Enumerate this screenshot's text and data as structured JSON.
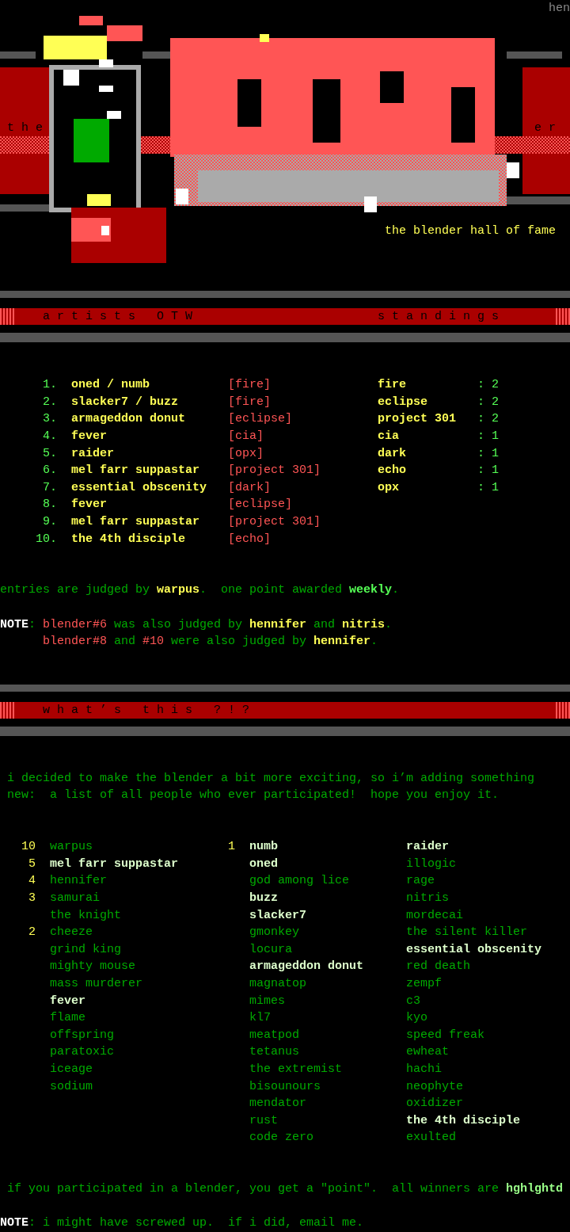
{
  "signature": "hen",
  "logo": {
    "prefix": "t h e",
    "suffix": "e r"
  },
  "tagline": "the blender hall of fame",
  "artists_section": {
    "heading": "a r t i s t s   O T W",
    "heading_right": "s t a n d i n g s",
    "winners": [
      {
        "rank": "1.",
        "artists": "oned / numb",
        "group": "[fire]"
      },
      {
        "rank": "2.",
        "artists": "slacker7 / buzz",
        "group": "[fire]"
      },
      {
        "rank": "3.",
        "artists": "armageddon donut",
        "group": "[eclipse]"
      },
      {
        "rank": "4.",
        "artists": "fever",
        "group": "[cia]"
      },
      {
        "rank": "5.",
        "artists": "raider",
        "group": "[opx]"
      },
      {
        "rank": "6.",
        "artists": "mel farr suppastar",
        "group": "[project 301]"
      },
      {
        "rank": "7.",
        "artists": "essential obscenity",
        "group": "[dark]"
      },
      {
        "rank": "8.",
        "artists": "fever",
        "group": "[eclipse]"
      },
      {
        "rank": "9.",
        "artists": "mel farr suppastar",
        "group": "[project 301]"
      },
      {
        "rank": "10.",
        "artists": "the 4th disciple",
        "group": "[echo]"
      }
    ],
    "standings": [
      {
        "group": "fire",
        "separator": ":",
        "points": "2"
      },
      {
        "group": "eclipse",
        "separator": ":",
        "points": "2"
      },
      {
        "group": "project 301",
        "separator": ":",
        "points": "2"
      },
      {
        "group": "cia",
        "separator": ":",
        "points": "1"
      },
      {
        "group": "dark",
        "separator": ":",
        "points": "1"
      },
      {
        "group": "echo",
        "separator": ":",
        "points": "1"
      },
      {
        "group": "opx",
        "separator": ":",
        "points": "1"
      }
    ],
    "judging": [
      {
        "text": "entries are judged by ",
        "kind": "plain"
      },
      {
        "text": "warpus",
        "kind": "name"
      },
      {
        "text": ".  one point awarded ",
        "kind": "plain"
      },
      {
        "text": "weekly",
        "kind": "highlight"
      },
      {
        "text": ".",
        "kind": "plain"
      }
    ],
    "note": {
      "label": [
        {
          "text": "NOTE",
          "kind": "label"
        },
        {
          "text": ":",
          "kind": "plain"
        }
      ],
      "lines": [
        [
          {
            "text": "blender#6",
            "kind": "tag"
          },
          {
            "text": " was also judged by ",
            "kind": "plain"
          },
          {
            "text": "hennifer",
            "kind": "name"
          },
          {
            "text": " and ",
            "kind": "plain"
          },
          {
            "text": "nitris",
            "kind": "name"
          },
          {
            "text": ".",
            "kind": "plain"
          }
        ],
        [
          {
            "text": "blender#8",
            "kind": "tag"
          },
          {
            "text": " and ",
            "kind": "plain"
          },
          {
            "text": "#10",
            "kind": "tag"
          },
          {
            "text": " were also judged by ",
            "kind": "plain"
          },
          {
            "text": "hennifer",
            "kind": "name"
          },
          {
            "text": ".",
            "kind": "plain"
          }
        ]
      ]
    }
  },
  "about_section": {
    "heading": "w h a t ’ s   t h i s   ? ! ?",
    "intro_lines": [
      "i decided to make the blender a bit more exciting, so i’m adding something",
      "new:  a list of all people who ever participated!  hope you enjoy it."
    ],
    "participants": [
      [
        {
          "points": "10",
          "name": "warpus",
          "winner": false
        },
        {
          "points": "5",
          "name": "mel farr suppastar",
          "winner": true
        },
        {
          "points": "4",
          "name": "hennifer",
          "winner": false
        },
        {
          "points": "3",
          "name": "samurai",
          "winner": false
        },
        {
          "name": "the knight",
          "winner": false
        },
        {
          "points": "2",
          "name": "cheeze",
          "winner": false
        },
        {
          "name": "grind king",
          "winner": false
        },
        {
          "name": "mighty mouse",
          "winner": false
        },
        {
          "name": "mass murderer",
          "winner": false
        },
        {
          "name": "fever",
          "winner": true
        },
        {
          "name": "flame",
          "winner": false
        },
        {
          "name": "offspring",
          "winner": false
        },
        {
          "name": "paratoxic",
          "winner": false
        },
        {
          "name": "iceage",
          "winner": false
        },
        {
          "name": "sodium",
          "winner": false
        }
      ],
      [
        {
          "points": "1",
          "name": "numb",
          "winner": true
        },
        {
          "name": "oned",
          "winner": true
        },
        {
          "name": "god among lice",
          "winner": false
        },
        {
          "name": "buzz",
          "winner": true
        },
        {
          "name": "slacker7",
          "winner": true
        },
        {
          "name": "gmonkey",
          "winner": false
        },
        {
          "name": "locura",
          "winner": false
        },
        {
          "name": "armageddon donut",
          "winner": true
        },
        {
          "name": "magnatop",
          "winner": false
        },
        {
          "name": "mimes",
          "winner": false
        },
        {
          "name": "kl7",
          "winner": false
        },
        {
          "name": "meatpod",
          "winner": false
        },
        {
          "name": "tetanus",
          "winner": false
        },
        {
          "name": "the extremist",
          "winner": false
        },
        {
          "name": "bisounours",
          "winner": false
        },
        {
          "name": "mendator",
          "winner": false
        },
        {
          "name": "rust",
          "winner": false
        },
        {
          "name": "code zero",
          "winner": false
        }
      ],
      [
        {
          "name": "raider",
          "winner": true
        },
        {
          "name": "illogic",
          "winner": false
        },
        {
          "name": "rage",
          "winner": false
        },
        {
          "name": "nitris",
          "winner": false
        },
        {
          "name": "mordecai",
          "winner": false
        },
        {
          "name": "the silent killer",
          "winner": false
        },
        {
          "name": "essential obscenity",
          "winner": true
        },
        {
          "name": "red death",
          "winner": false
        },
        {
          "name": "zempf",
          "winner": false
        },
        {
          "name": "c3",
          "winner": false
        },
        {
          "name": "kyo",
          "winner": false
        },
        {
          "name": "speed freak",
          "winner": false
        },
        {
          "name": "ewheat",
          "winner": false
        },
        {
          "name": "hachi",
          "winner": false
        },
        {
          "name": "neophyte",
          "winner": false
        },
        {
          "name": "oxidizer",
          "winner": false
        },
        {
          "name": "the 4th disciple",
          "winner": true
        },
        {
          "name": "exulted",
          "winner": false
        }
      ]
    ],
    "points_info": [
      {
        "text": "if you participated in a blender, you get a \"point\".  all winners are ",
        "kind": "plain"
      },
      {
        "text": "hghlghtd",
        "kind": "winner"
      }
    ],
    "final_note": [
      {
        "text": "NOTE",
        "kind": "label"
      },
      {
        "text": ": i might have screwed up.  if i did, email me.",
        "kind": "plain"
      }
    ]
  }
}
